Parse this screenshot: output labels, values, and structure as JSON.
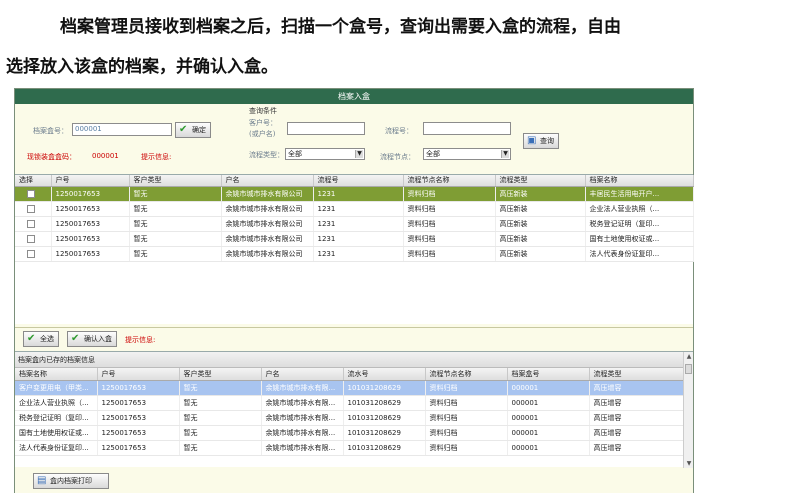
{
  "doc": {
    "line1": "档案管理员接收到档案之后，扫描一个盒号，查询出需要入盒的流程，自由",
    "line2": "选择放入该盒的档案，并确认入盒。"
  },
  "window": {
    "title": "档案入盒"
  },
  "query": {
    "box_label": "档案盒号：",
    "box_value": "000001",
    "confirm_label": "确定",
    "locked_label": "现锁装盒盒码：",
    "locked_value": "000001",
    "hint_label": "提示信息:",
    "cond_title": "查询条件",
    "customer_label_1": "客户号：",
    "customer_label_2": "(或户名)",
    "customer_value": "",
    "flowno_label": "流程号：",
    "flowno_value": "",
    "query_button": "查询",
    "flowtype_label": "流程类型：",
    "flowtype_value": "全部",
    "flownode_label": "流程节点：",
    "flownode_value": "全部"
  },
  "grid1": {
    "headers": [
      "选择",
      "户号",
      "客户类型",
      "户名",
      "流程号",
      "流程节点名称",
      "流程类型",
      "档案名称"
    ],
    "rows": [
      [
        "",
        "1250017653",
        "暂无",
        "余姚市城市排水有限公司",
        "1231",
        "资料归档",
        "高压新装",
        "丰居民生活用电开户..."
      ],
      [
        "",
        "1250017653",
        "暂无",
        "余姚市城市排水有限公司",
        "1231",
        "资料归档",
        "高压新装",
        "企业法人营业执照（..."
      ],
      [
        "",
        "1250017653",
        "暂无",
        "余姚市城市排水有限公司",
        "1231",
        "资料归档",
        "高压新装",
        "税务登记证明（复印..."
      ],
      [
        "",
        "1250017653",
        "暂无",
        "余姚市城市排水有限公司",
        "1231",
        "资料归档",
        "高压新装",
        "国有土地使用权证或..."
      ],
      [
        "",
        "1250017653",
        "暂无",
        "余姚市城市排水有限公司",
        "1231",
        "资料归档",
        "高压新装",
        "法人代表身份证复印..."
      ]
    ]
  },
  "actions": {
    "select_all": "全选",
    "confirm_box": "确认入盒",
    "hint_label": "提示信息:"
  },
  "grid2": {
    "title": "档案盒内已存的档案信息",
    "headers": [
      "档案名称",
      "户号",
      "客户类型",
      "户名",
      "流水号",
      "流程节点名称",
      "档案盒号",
      "流程类型"
    ],
    "rows": [
      [
        "客户变更用电（甲类...",
        "1250017653",
        "暂无",
        "余姚市城市排水有限...",
        "101031208629",
        "资料归档",
        "000001",
        "高压增容"
      ],
      [
        "企业法人营业执照（...",
        "1250017653",
        "暂无",
        "余姚市城市排水有限...",
        "101031208629",
        "资料归档",
        "000001",
        "高压增容"
      ],
      [
        "税务登记证明（复印...",
        "1250017653",
        "暂无",
        "余姚市城市排水有限...",
        "101031208629",
        "资料归档",
        "000001",
        "高压增容"
      ],
      [
        "国有土地使用权证或...",
        "1250017653",
        "暂无",
        "余姚市城市排水有限...",
        "101031208629",
        "资料归档",
        "000001",
        "高压增容"
      ],
      [
        "法人代表身份证复印...",
        "1250017653",
        "暂无",
        "余姚市城市排水有限...",
        "101031208629",
        "资料归档",
        "000001",
        "高压增容"
      ]
    ]
  },
  "print": {
    "label": "盒内档案打印"
  },
  "icons": {
    "confirm": "check-icon",
    "query": "search-icon",
    "print": "printer-icon",
    "row_pointer": "row-pointer-icon"
  }
}
